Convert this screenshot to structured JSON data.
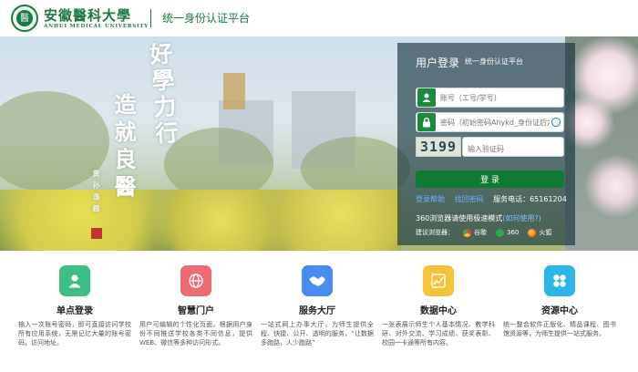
{
  "header": {
    "logo_cn": "安徽醫科大學",
    "logo_en": "ANHUI MEDICAL UNIVERSITY",
    "platform_title": "统一身份认证平台"
  },
  "banner": {
    "calligraphy_main": "好學力行",
    "calligraphy_second": "造就良醫",
    "signature": "黄 孙 逸 题"
  },
  "login": {
    "title": "用户登录",
    "subtitle": "统一身份认证平台",
    "username_placeholder": "账号（工号/学号）",
    "password_placeholder": "密码（初始密码Ahykd_身份证后六位）",
    "captcha_code": "3199",
    "captcha_placeholder": "输入验证码",
    "login_button": "登 录",
    "help_link": "登录帮助",
    "retrieve_link": "找回密码",
    "service_phone": "服务电话：65161204",
    "browser_tip": "360浏览器请使用极速模式",
    "browser_tip_link": "(如何使用?)",
    "recommend_label": "建议浏览器：",
    "browsers": [
      {
        "name": "谷歌",
        "color": "#e8453c"
      },
      {
        "name": "360",
        "color": "#2fa84f"
      },
      {
        "name": "火狐",
        "color": "#f57b22"
      }
    ]
  },
  "features": [
    {
      "title": "单点登录",
      "icon": "user-icon",
      "color": "#3cbf86",
      "desc": "输入一次账号密码，即可直接访问学校所有应用系统，无需记忆大量的账号密码，访问地址。"
    },
    {
      "title": "智慧门户",
      "icon": "globe-icon",
      "color": "#f06a72",
      "desc": "用户可编辑的个性化页面，根据用户身份不同推送学校各类不同信息，提供WEB、微信等多种访问形式。"
    },
    {
      "title": "服务大厅",
      "icon": "handshake-icon",
      "color": "#4a8cf0",
      "desc": "一站式网上办事大厅，为师生提供全程、快捷、公开、透明的服务，“让数据多跑路，人少跑路”"
    },
    {
      "title": "数据中心",
      "icon": "chart-icon",
      "color": "#f5c23a",
      "desc": "一张表展示师生个人基本情况、教学科研、对外交流、学习成绩、获奖表彰、校园一卡通等所有内容。"
    },
    {
      "title": "资源中心",
      "icon": "flower-icon",
      "color": "#2db7e8",
      "desc": "统一整合软件正版化、精品课程、图书馆资源等，为师生提供一站式服务。"
    }
  ]
}
